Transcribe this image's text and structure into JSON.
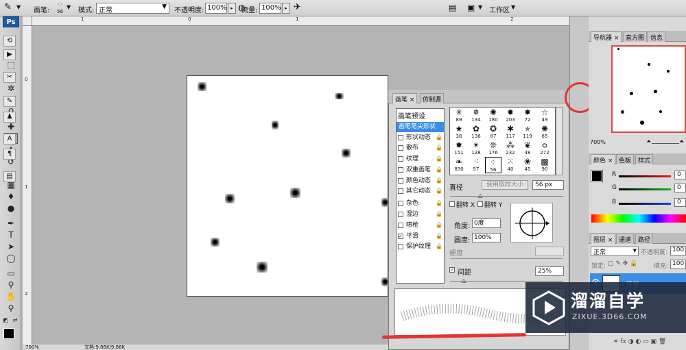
{
  "options_bar": {
    "brush_label": "画笔:",
    "brush_size": "56",
    "mode_label": "模式:",
    "mode_value": "正常",
    "opacity_label": "不透明度:",
    "opacity_value": "100%",
    "flow_label": "流量:",
    "flow_value": "100%",
    "workspace_label": "工作区"
  },
  "toolbox": {
    "app_badge": "Ps"
  },
  "rulers": {
    "h_labels": [
      "1",
      "0",
      "1",
      "2"
    ],
    "v_labels": [
      "0",
      "1",
      "2"
    ]
  },
  "status": {
    "zoom": "700%",
    "doc": "文档:9.86K/9.86K"
  },
  "navigator_panel": {
    "tabs": [
      "导航器",
      "直方图",
      "信息"
    ],
    "zoom": "700%"
  },
  "color_panel": {
    "tabs": [
      "颜色",
      "色板",
      "样式"
    ],
    "channels": [
      {
        "label": "R",
        "value": "0",
        "color": "#e02020"
      },
      {
        "label": "G",
        "value": "0",
        "color": "#20b020"
      },
      {
        "label": "B",
        "value": "0",
        "color": "#2040e0"
      }
    ]
  },
  "layers_panel": {
    "tabs": [
      "图层",
      "通道",
      "路径"
    ],
    "blend_mode": "正常",
    "opacity_label": "不透明度:",
    "opacity_value": "100",
    "lock_label": "锁定:",
    "fill_label": "填充:",
    "fill_value": "100",
    "layer_name": "背景"
  },
  "brush_panel": {
    "tabs": [
      "画笔",
      "仿制源"
    ],
    "presets_label": "画笔预设",
    "options": [
      {
        "label": "画笔笔尖形状",
        "checkbox": false,
        "selected": true
      },
      {
        "label": "形状动态",
        "checkbox": true,
        "checked": false,
        "lock": true
      },
      {
        "label": "散布",
        "checkbox": true,
        "checked": false,
        "lock": true
      },
      {
        "label": "纹理",
        "checkbox": true,
        "checked": false,
        "lock": true
      },
      {
        "label": "双重画笔",
        "checkbox": true,
        "checked": false,
        "lock": true
      },
      {
        "label": "颜色动态",
        "checkbox": true,
        "checked": false,
        "lock": true
      },
      {
        "label": "其它动态",
        "checkbox": true,
        "checked": false,
        "lock": true
      },
      {
        "label": "杂色",
        "checkbox": true,
        "checked": false,
        "lock": true
      },
      {
        "label": "湿边",
        "checkbox": true,
        "checked": false,
        "lock": true
      },
      {
        "label": "喷枪",
        "checkbox": true,
        "checked": false,
        "lock": true
      },
      {
        "label": "平滑",
        "checkbox": true,
        "checked": true,
        "lock": true
      },
      {
        "label": "保护纹理",
        "checkbox": true,
        "checked": false,
        "lock": true
      }
    ],
    "tip_numbers": [
      "89",
      "134",
      "180",
      "203",
      "72",
      "49",
      "38",
      "136",
      "87",
      "117",
      "119",
      "65",
      "151",
      "128",
      "176",
      "232",
      "48",
      "272",
      "830",
      "57",
      "56",
      "40",
      "45",
      "90"
    ],
    "diameter_label": "直径",
    "use_sample_size": "使用取样大小",
    "diameter_value": "56 px",
    "flip_x": "翻转 X",
    "flip_y": "翻转 Y",
    "angle_label": "角度:",
    "angle_value": "0度",
    "roundness_label": "圆度:",
    "roundness_value": "100%",
    "hardness_label": "硬度",
    "spacing_label": "间距",
    "spacing_value": "25%"
  },
  "watermark": {
    "brand": "溜溜自学",
    "url": "ZIXUE.3D66.COM"
  },
  "colors": {
    "annotation_red": "#e53333",
    "selection_blue": "#3a8ee6",
    "ps_blue": "#1e5aa8"
  }
}
